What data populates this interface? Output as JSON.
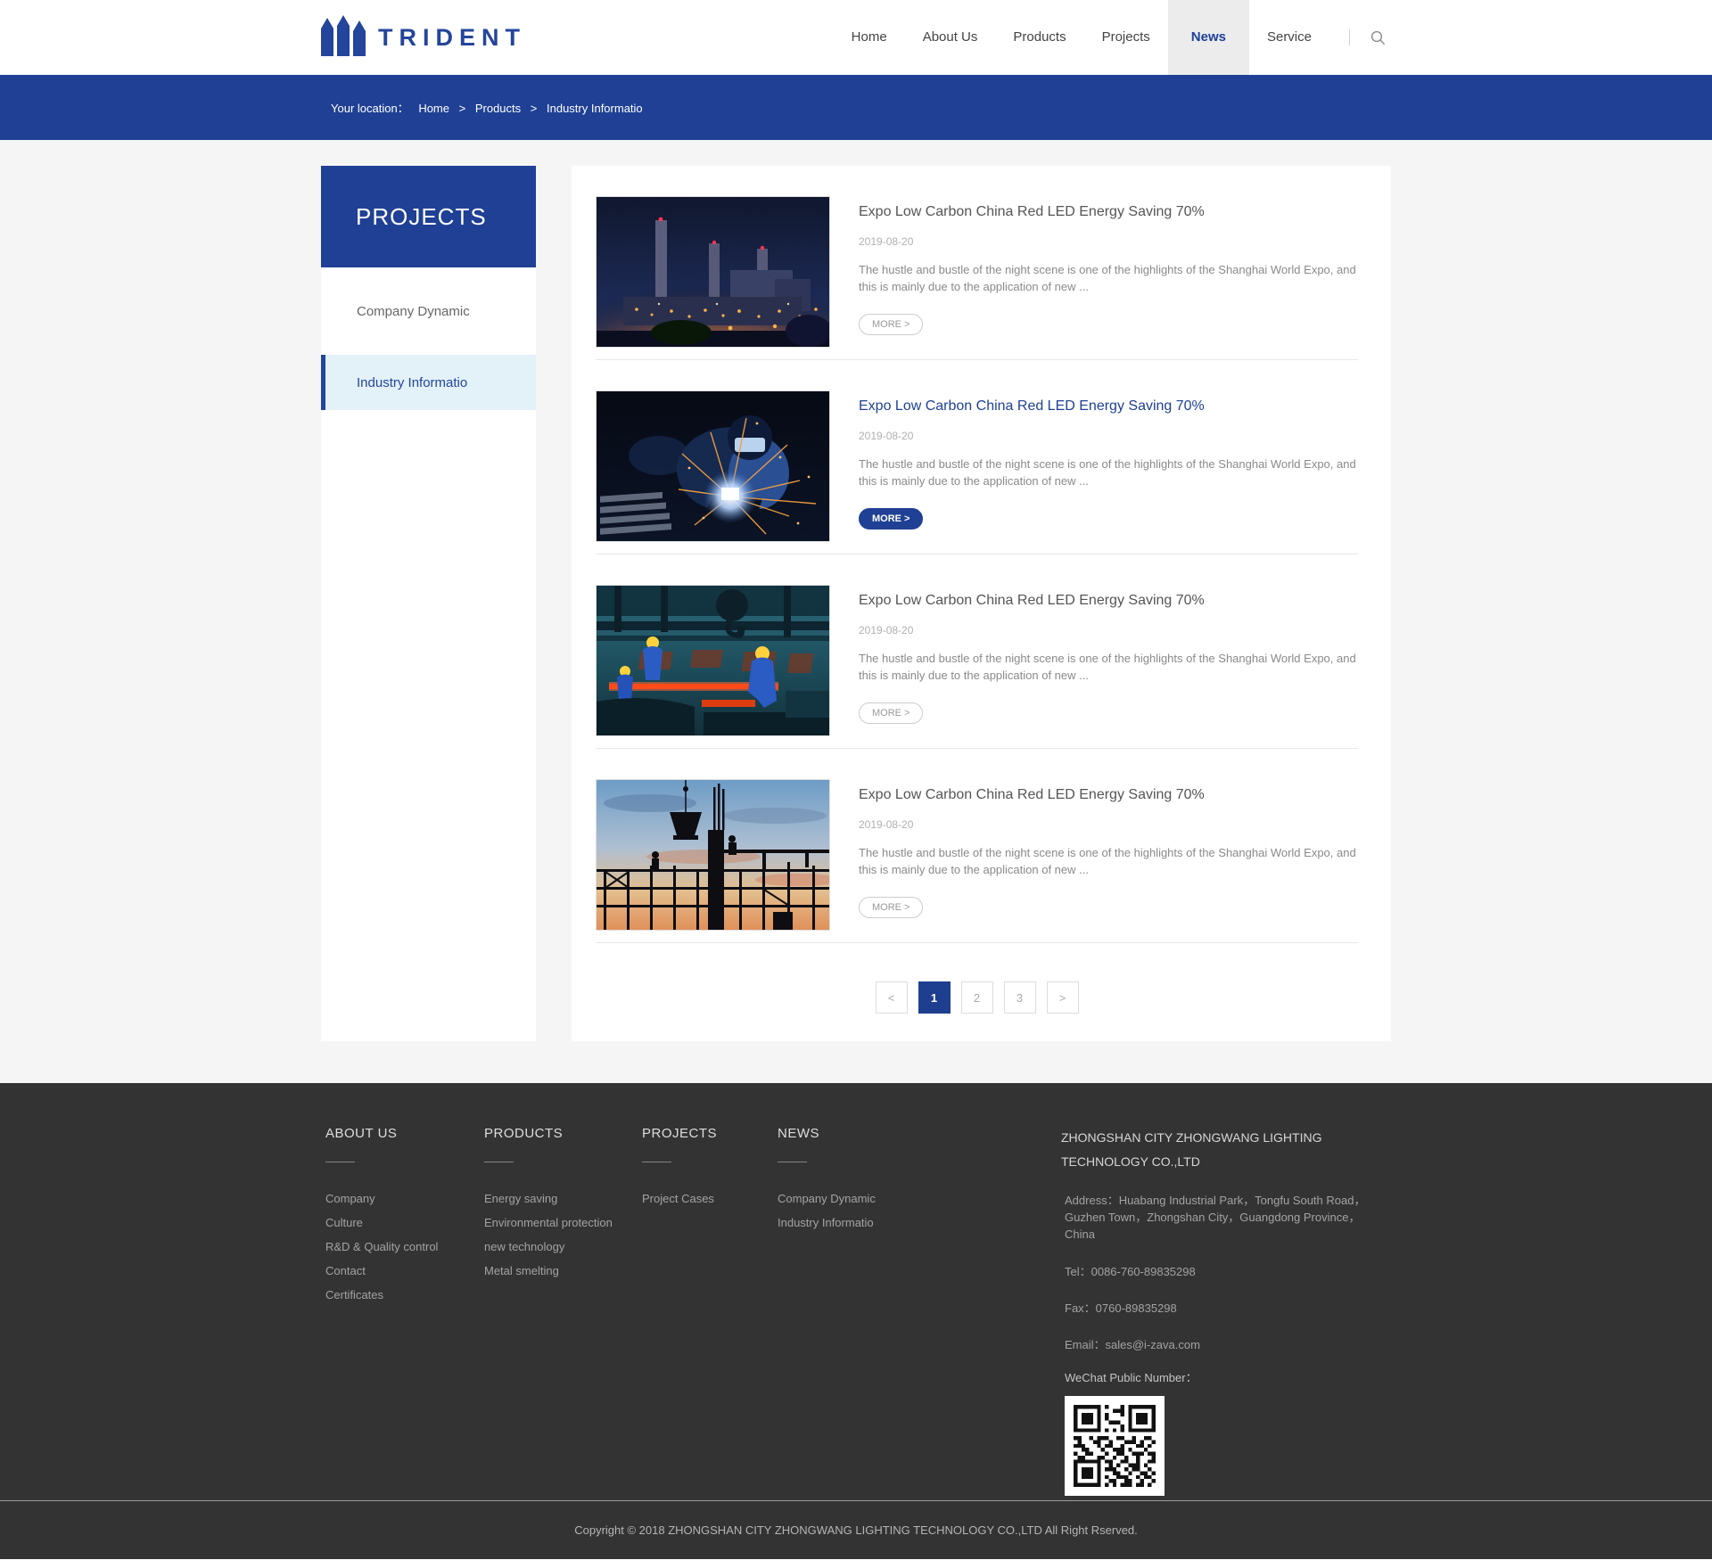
{
  "brand": {
    "name": "TRIDENT"
  },
  "nav": {
    "items": [
      {
        "label": "Home",
        "active": false
      },
      {
        "label": "About Us",
        "active": false
      },
      {
        "label": "Products",
        "active": false
      },
      {
        "label": "Projects",
        "active": false
      },
      {
        "label": "News",
        "active": true
      },
      {
        "label": "Service",
        "active": false
      }
    ],
    "search_icon": "magnifier"
  },
  "breadcrumb": {
    "prefix": "Your location：",
    "separator": ">",
    "items": [
      "Home",
      "Products",
      "Industry Informatio"
    ]
  },
  "sidebar": {
    "title": "PROJECTS",
    "items": [
      {
        "label": "Company Dynamic",
        "active": false
      },
      {
        "label": "Industry Informatio",
        "active": true
      }
    ]
  },
  "news": {
    "items": [
      {
        "title": "Expo Low Carbon China Red LED Energy Saving 70%",
        "date": "2019-08-20",
        "excerpt": "The hustle and bustle of the night scene is one of the highlights of the Shanghai World Expo, and this is mainly due to the application of new ...",
        "more_label": "MORE >",
        "highlighted": false,
        "image": "power-plant-night"
      },
      {
        "title": "Expo Low Carbon China Red LED Energy Saving 70%",
        "date": "2019-08-20",
        "excerpt": "The hustle and bustle of the night scene is one of the highlights of the Shanghai World Expo, and this is mainly due to the application of new ...",
        "more_label": "MORE >",
        "highlighted": true,
        "image": "welding-sparks"
      },
      {
        "title": "Expo Low Carbon China Red LED Energy Saving 70%",
        "date": "2019-08-20",
        "excerpt": "The hustle and bustle of the night scene is one of the highlights of the Shanghai World Expo, and this is mainly due to the application of new ...",
        "more_label": "MORE >",
        "highlighted": false,
        "image": "steel-factory-workers"
      },
      {
        "title": "Expo Low Carbon China Red LED Energy Saving 70%",
        "date": "2019-08-20",
        "excerpt": "The hustle and bustle of the night scene is one of the highlights of the Shanghai World Expo, and this is mainly due to the application of new ...",
        "more_label": "MORE >",
        "highlighted": false,
        "image": "construction-silhouette"
      }
    ]
  },
  "pagination": {
    "prev_label": "<",
    "next_label": ">",
    "pages": [
      "1",
      "2",
      "3"
    ],
    "active_page": "1"
  },
  "footer": {
    "columns": [
      {
        "heading": "ABOUT US",
        "links": [
          "Company",
          "Culture",
          "R&D & Quality control",
          "Contact",
          "Certificates"
        ]
      },
      {
        "heading": "PRODUCTS",
        "links": [
          "Energy saving",
          "Environmental protection",
          "new technology",
          "Metal smelting"
        ]
      },
      {
        "heading": "PROJECTS",
        "links": [
          "Project Cases"
        ]
      },
      {
        "heading": "NEWS",
        "links": [
          "Company Dynamic",
          "Industry Informatio"
        ]
      }
    ],
    "company": {
      "name_line1": "ZHONGSHAN CITY ZHONGWANG LIGHTING",
      "name_line2": "TECHNOLOGY CO.,LTD",
      "address": "Address：Huabang Industrial Park，Tongfu South Road，Guzhen Town，Zhongshan City，Guangdong Province，China",
      "tel": "Tel：0086-760-89835298",
      "fax": "Fax：0760-89835298",
      "email": "Email：sales@i-zava.com",
      "wechat_label": "WeChat Public Number："
    }
  },
  "copyright": "Copyright © 2018 ZHONGSHAN CITY ZHONGWANG LIGHTING TECHNOLOGY CO.,LTD All Right Rserved.",
  "colors": {
    "brand_blue": "#1f4094",
    "nav_active_bg": "#ececec",
    "sidebar_active_bg": "#e3f1f9",
    "page_bg": "#f5f5f5",
    "footer_bg": "#333333"
  }
}
